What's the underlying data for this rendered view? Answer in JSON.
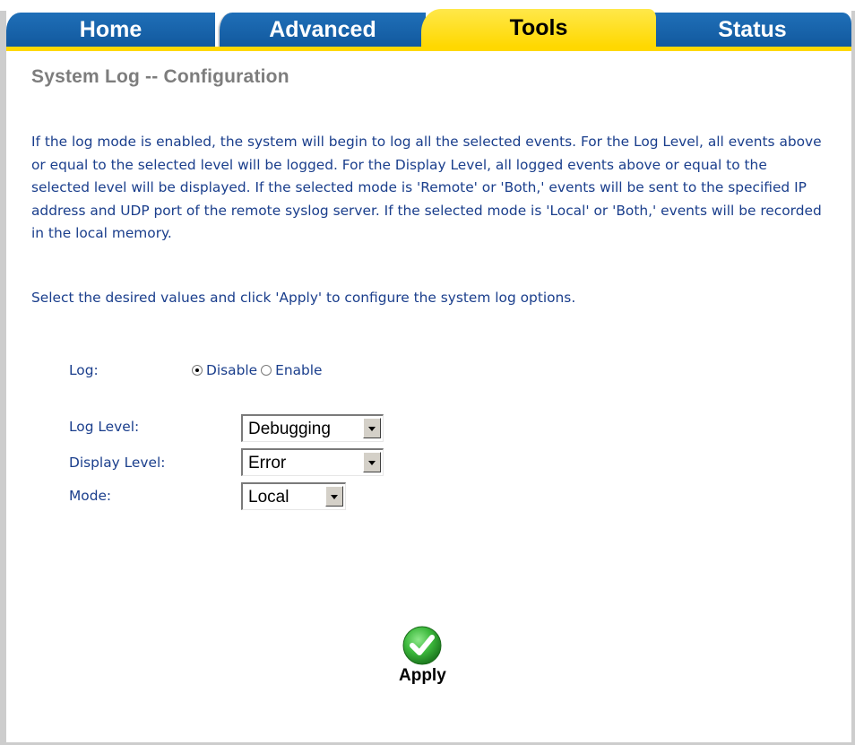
{
  "tabs": [
    {
      "label": "Home",
      "active": false
    },
    {
      "label": "Advanced",
      "active": false
    },
    {
      "label": "Tools",
      "active": true
    },
    {
      "label": "Status",
      "active": false
    }
  ],
  "page_title": "System Log -- Configuration",
  "description": "If the log mode is enabled, the system will begin to log all the selected events. For the Log Level, all events above or equal to the selected level will be logged. For the Display Level, all logged events above or equal to the selected level will be displayed. If the selected mode is 'Remote' or 'Both,' events will be sent to the specified IP address and UDP port of the remote syslog server. If the selected mode is 'Local' or 'Both,' events will be recorded in the local memory.",
  "instructions": "Select the desired values and click 'Apply' to configure the system log options.",
  "form": {
    "log": {
      "label": "Log:",
      "options": [
        "Disable",
        "Enable"
      ],
      "selected": "Disable"
    },
    "log_level": {
      "label": "Log Level:",
      "value": "Debugging"
    },
    "display_level": {
      "label": "Display Level:",
      "value": "Error"
    },
    "mode": {
      "label": "Mode:",
      "value": "Local"
    }
  },
  "apply_label": "Apply",
  "colors": {
    "tab_blue": "#1565b0",
    "tab_active": "#ffd800",
    "body_text": "#1a3e8c",
    "title_text": "#7d7d7d",
    "apply_green": "#3cb83c"
  },
  "icons": {
    "apply": "checkmark-icon",
    "dropdown": "chevron-down-icon"
  }
}
